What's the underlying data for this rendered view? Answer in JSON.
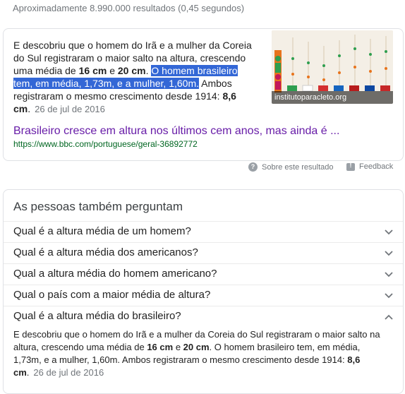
{
  "results_stats": "Aproximadamente 8.990.000 resultados (0,45 segundos)",
  "snippet": {
    "text_1": "E descobriu que o homem do Irã e a mulher da Coreia do Sul registraram o maior salto na altura, crescendo uma média de ",
    "bold_1": "16 cm",
    "text_2": " e ",
    "bold_2": "20 cm",
    "text_3": ". ",
    "highlight": "O homem brasileiro tem, em média, 1,73m, e a mulher, 1,60m.",
    "text_4": " Ambos registraram o mesmo crescimento desde 1914: ",
    "bold_3": "8,6 cm",
    "text_5": ".",
    "date": "26 de jul de 2016",
    "image_caption": "institutoparacleto.org",
    "title": "Brasileiro cresce em altura nos últimos cem anos, mas ainda é ...",
    "url": "https://www.bbc.com/portuguese/geral-36892772",
    "colors": {
      "highlight_bg": "#3367d6",
      "title": "#681da8",
      "url": "#006621"
    }
  },
  "footer": {
    "about_label": "Sobre este resultado",
    "feedback_label": "Feedback"
  },
  "paa": {
    "title": "As pessoas também perguntam",
    "questions": [
      "Qual é a altura média de um homem?",
      "Qual é a altura média dos americanos?",
      "Qual a altura média do homem americano?",
      "Qual o país com a maior média de altura?",
      "Qual é a altura média do brasileiro?"
    ],
    "answer": {
      "text_1": "E descobriu que o homem do Irã e a mulher da Coreia do Sul registraram o maior salto na altura, crescendo uma média de ",
      "bold_1": "16 cm",
      "text_2": " e ",
      "bold_2": "20 cm",
      "text_3": ". O homem brasileiro tem, em média, 1,73m, e a mulher, 1,60m. Ambos registraram o mesmo crescimento desde 1914: ",
      "bold_3": "8,6 cm",
      "text_4": ".",
      "date": "26 de jul de 2016"
    }
  }
}
